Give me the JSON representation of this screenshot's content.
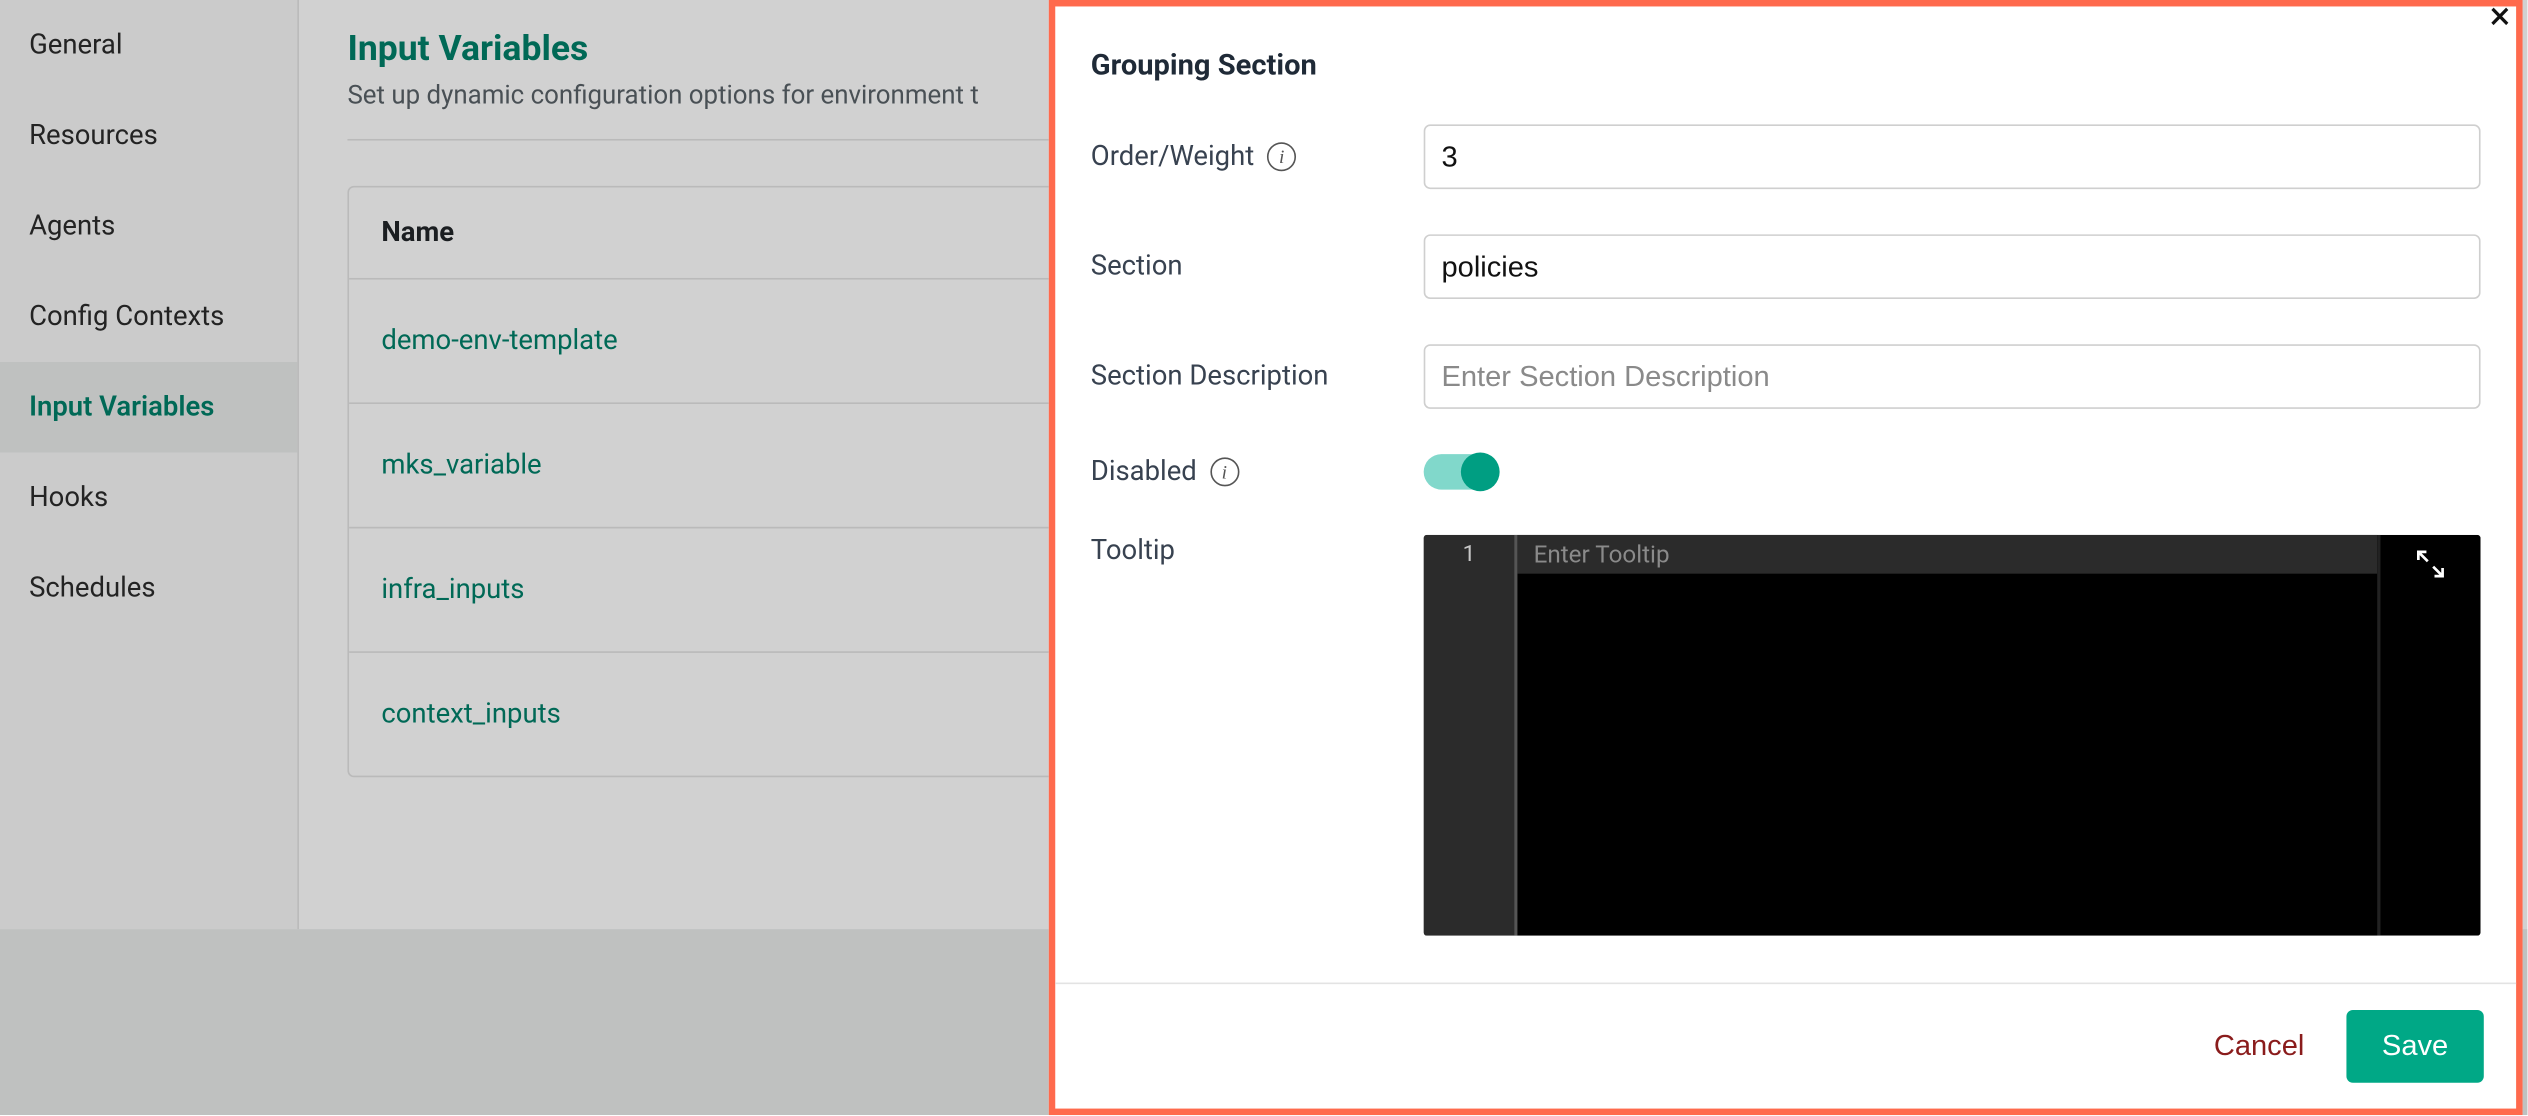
{
  "sidebar": {
    "items": [
      {
        "label": "General",
        "active": false
      },
      {
        "label": "Resources",
        "active": false
      },
      {
        "label": "Agents",
        "active": false
      },
      {
        "label": "Config Contexts",
        "active": false
      },
      {
        "label": "Input Variables",
        "active": true
      },
      {
        "label": "Hooks",
        "active": false
      },
      {
        "label": "Schedules",
        "active": false
      }
    ]
  },
  "main": {
    "heading": "Input Variables",
    "subtitle": "Set up dynamic configuration options for environment t",
    "table_header": "Name",
    "rows": [
      "demo-env-template",
      "mks_variable",
      "infra_inputs",
      "context_inputs"
    ]
  },
  "modal": {
    "title": "Grouping Section",
    "order": {
      "label": "Order/Weight",
      "value": "3"
    },
    "section": {
      "label": "Section",
      "value": "policies"
    },
    "section_desc": {
      "label": "Section Description",
      "placeholder": "Enter Section Description",
      "value": ""
    },
    "disabled": {
      "label": "Disabled",
      "on": true
    },
    "tooltip": {
      "label": "Tooltip",
      "placeholder": "Enter Tooltip",
      "line_number": "1"
    },
    "footer": {
      "cancel": "Cancel",
      "save": "Save"
    }
  }
}
